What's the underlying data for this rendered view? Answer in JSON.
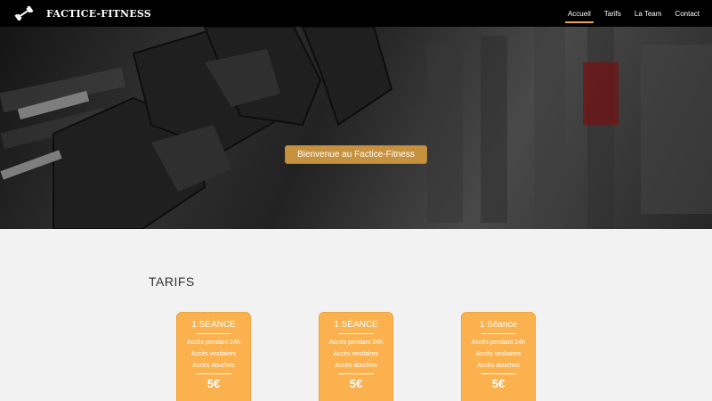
{
  "brand": {
    "name": "FACTICE-FITNESS",
    "icon": "dumbbell-icon"
  },
  "nav": {
    "items": [
      {
        "label": "Accueil",
        "active": true
      },
      {
        "label": "Tarifs",
        "active": false
      },
      {
        "label": "La Team",
        "active": false
      },
      {
        "label": "Contact",
        "active": false
      }
    ],
    "accent_color": "#e8a33d"
  },
  "hero": {
    "badge_text": "Bienvenue au Factice-Fitness"
  },
  "tarifs": {
    "title": "TARIFS",
    "cards": [
      {
        "title": "1 SÉANCE",
        "features": [
          "Accès pendant 24h",
          "Accès vestiaires",
          "Accès douches"
        ],
        "price": "5€"
      },
      {
        "title": "1 SÉANCE",
        "features": [
          "Accès pendant 24h",
          "Accès vestiaires",
          "Accès douches"
        ],
        "price": "5€"
      },
      {
        "title": "1 Séance",
        "features": [
          "Accès pendant 24h",
          "Accès vestiaires",
          "Accès douches"
        ],
        "price": "5€"
      }
    ],
    "card_color": "#fbb14e"
  }
}
